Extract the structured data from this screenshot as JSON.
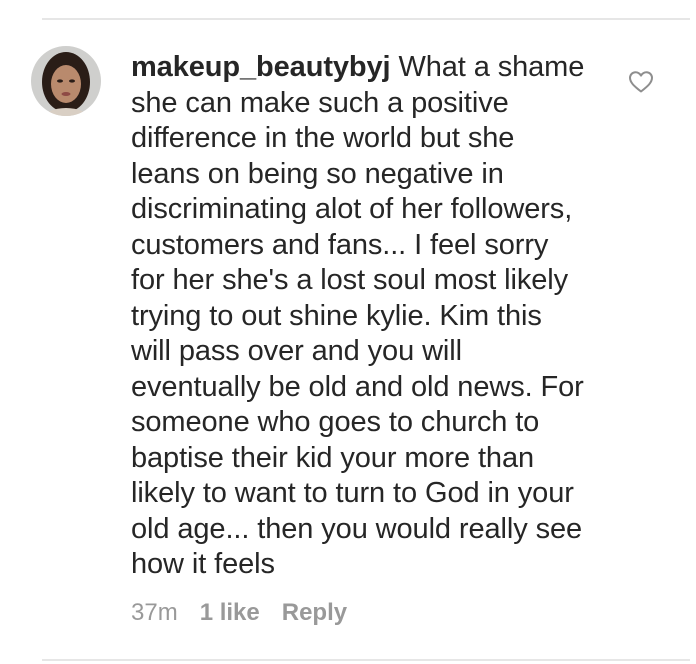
{
  "comment": {
    "username": "makeup_beautybyj",
    "text": "What a shame\nshe can make such a positive\ndifference in the world but she\nleans on being so negative in\ndiscriminating alot of her followers,\ncustomers and fans... I feel sorry\nfor her she's a lost soul most likely\ntrying to out shine kylie. Kim this\nwill pass over and you will\neventually be old and old news. For\nsomeone who goes to church to\nbaptise their kid your more than\nlikely to want to turn to God in your\nold age... then you would really see\nhow it feels",
    "time": "37m",
    "likes": "1 like",
    "reply_label": "Reply"
  },
  "icons": {
    "like": "heart-outline-icon",
    "avatar": "user-avatar"
  },
  "colors": {
    "text": "#262626",
    "meta": "#999999",
    "divider": "#e6e6e6"
  }
}
